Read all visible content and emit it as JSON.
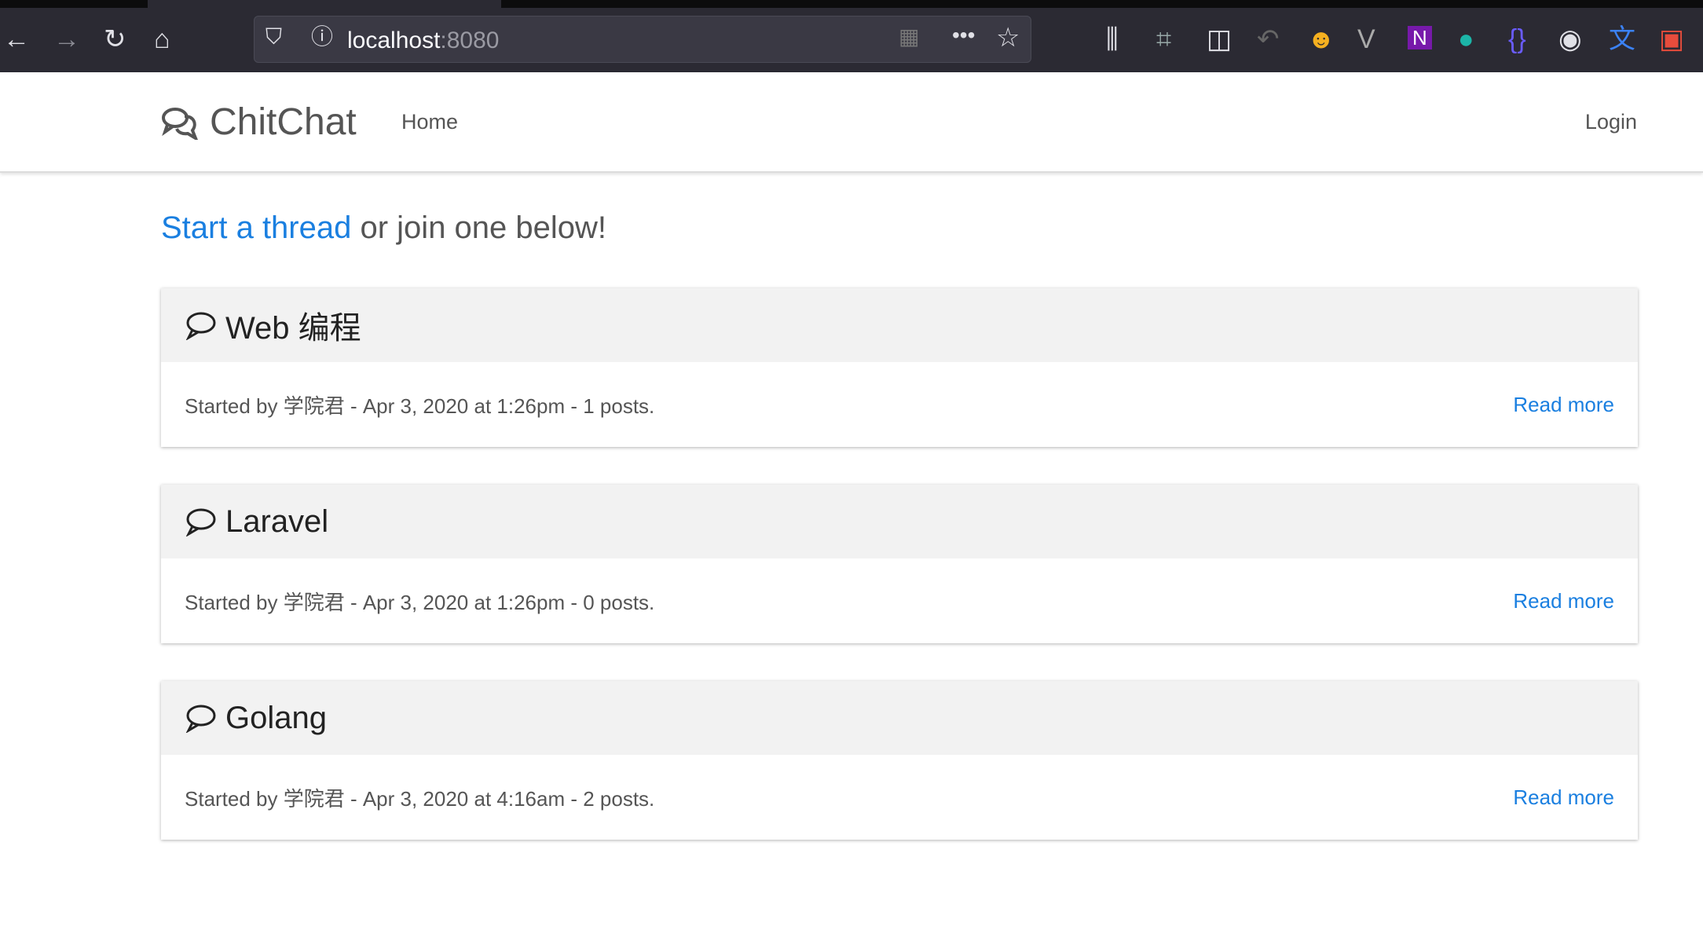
{
  "browser": {
    "url_host": "localhost",
    "url_port": ":8080"
  },
  "navbar": {
    "brand": "ChitChat",
    "home": "Home",
    "login": "Login"
  },
  "lead": {
    "link": "Start a thread",
    "rest": " or join one below!"
  },
  "threads": [
    {
      "title": "Web 编程",
      "meta": "Started by 学院君 - Apr 3, 2020 at 1:26pm - 1 posts.",
      "link": "Read more"
    },
    {
      "title": "Laravel",
      "meta": "Started by 学院君 - Apr 3, 2020 at 1:26pm - 0 posts.",
      "link": "Read more"
    },
    {
      "title": "Golang",
      "meta": "Started by 学院君 - Apr 3, 2020 at 4:16am - 2 posts.",
      "link": "Read more"
    }
  ],
  "colors": {
    "link": "#1a7fe0",
    "header_bg": "#f2f2f2"
  }
}
